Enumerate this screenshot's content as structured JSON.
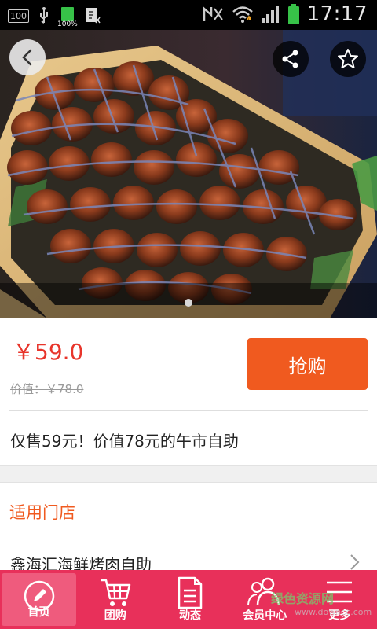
{
  "status_bar": {
    "left_box": "100",
    "battery_pct": "100%",
    "time": "17:17"
  },
  "product": {
    "price": "￥59.0",
    "original_price": "价值：￥78.0",
    "buy_label": "抢购",
    "description": "仅售59元！价值78元的午市自助"
  },
  "stores": {
    "title": "适用门店",
    "items": [
      "鑫海汇海鲜烤肉自助"
    ]
  },
  "nav": {
    "items": [
      {
        "label": "首页",
        "icon": "pencil-icon"
      },
      {
        "label": "团购",
        "icon": "cart-icon"
      },
      {
        "label": "动态",
        "icon": "document-icon"
      },
      {
        "label": "会员中心",
        "icon": "users-icon"
      },
      {
        "label": "更多",
        "icon": "menu-icon"
      }
    ]
  },
  "watermark": {
    "text": "绿色资源网",
    "url": "www.downcc.com"
  },
  "colors": {
    "price": "#e8352b",
    "buy_button": "#f05a1f",
    "nav_bg": "#e8305a",
    "section_title": "#f05a1f"
  }
}
